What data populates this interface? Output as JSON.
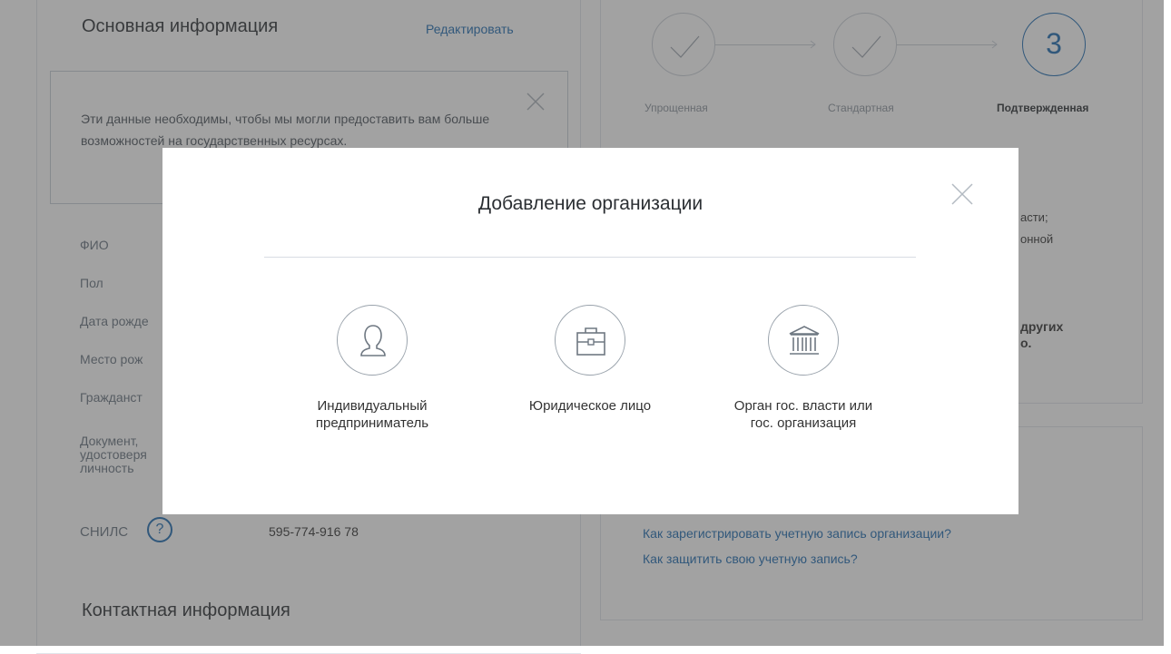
{
  "basic_info": {
    "title": "Основная информация",
    "edit_link": "Редактировать",
    "notice_text": "Эти данные необходимы, чтобы мы могли предоставить вам больше возможностей на государственных ресурсах.",
    "fields": [
      {
        "label": "ФИО"
      },
      {
        "label": "Пол"
      },
      {
        "label": "Дата рожде"
      },
      {
        "label": "Место рож"
      },
      {
        "label": "Гражданст"
      },
      {
        "label": "Документ,\nудостоверя\nличность"
      }
    ],
    "snils_label": "СНИЛС",
    "snils_help": "?",
    "snils_value": "595-774-916 78",
    "contact_title": "Контактная информация"
  },
  "account_levels": {
    "steps": [
      {
        "label": "Упрощенная",
        "state": "done"
      },
      {
        "label": "Стандартная",
        "state": "done"
      },
      {
        "label": "Подтвержденная",
        "number": "3",
        "state": "current"
      }
    ],
    "partial_text_1": "асти;",
    "partial_text_2": "онной",
    "partial_text_3": "других",
    "partial_text_4": "о."
  },
  "help_links": [
    "Как зарегистрировать учетную запись организации?",
    "Как защитить свою учетную запись?"
  ],
  "modal": {
    "title": "Добавление организации",
    "options": [
      {
        "label": "Индивидуальный предприниматель",
        "icon": "person-icon"
      },
      {
        "label": "Юридическое лицо",
        "icon": "briefcase-icon"
      },
      {
        "label": "Орган гос. власти или гос. организация",
        "icon": "government-building-icon"
      }
    ]
  },
  "colors": {
    "link": "#1d6ab0",
    "overlay": "rgba(70,70,70,0.5)"
  }
}
